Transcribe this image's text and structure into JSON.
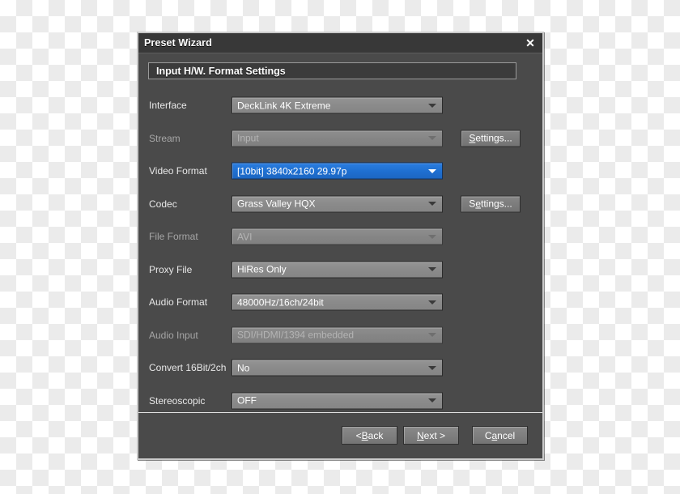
{
  "window": {
    "title": "Preset Wizard",
    "close_icon": "close-icon",
    "close_glyph": "✕"
  },
  "section": {
    "header": "Input H/W. Format Settings"
  },
  "form": {
    "rows": [
      {
        "label": "Interface",
        "value": "DeckLink 4K Extreme",
        "state": "normal",
        "side_button": null
      },
      {
        "label": "Stream",
        "value": "Input",
        "state": "disabled",
        "side_button": "Settings..."
      },
      {
        "label": "Video Format",
        "value": "[10bit] 3840x2160 29.97p",
        "state": "selected",
        "side_button": null
      },
      {
        "label": "Codec",
        "value": "Grass Valley HQX",
        "state": "normal",
        "side_button": "Settings..."
      },
      {
        "label": "File Format",
        "value": "AVI",
        "state": "disabled",
        "side_button": null
      },
      {
        "label": "Proxy File",
        "value": "HiRes Only",
        "state": "normal",
        "side_button": null
      },
      {
        "label": "Audio Format",
        "value": "48000Hz/16ch/24bit",
        "state": "normal",
        "side_button": null
      },
      {
        "label": "Audio Input",
        "value": "SDI/HDMI/1394 embedded",
        "state": "disabled",
        "side_button": null
      },
      {
        "label": "Convert 16Bit/2ch",
        "value": "No",
        "state": "normal",
        "side_button": null
      },
      {
        "label": "Stereoscopic",
        "value": "OFF",
        "state": "normal",
        "side_button": null
      }
    ]
  },
  "side_buttons": {
    "stream_settings": {
      "prefix": "",
      "mnemonic": "S",
      "suffix": "ettings..."
    },
    "codec_settings": {
      "prefix": "S",
      "mnemonic": "e",
      "suffix": "ttings..."
    }
  },
  "footer": {
    "back": {
      "prefix": "< ",
      "mnemonic": "B",
      "suffix": "ack"
    },
    "next": {
      "prefix": "",
      "mnemonic": "N",
      "suffix": "ext >"
    },
    "cancel": {
      "prefix": "C",
      "mnemonic": "a",
      "suffix": "ncel"
    }
  },
  "colors": {
    "dialog_border": "#c9c9c9",
    "titlebar": "#383838",
    "body": "#4a4a4a",
    "combo": "#8a8a8a",
    "accent_selected": "#1f6fd0",
    "text": "#ffffff",
    "text_disabled": "#b4b4b4"
  }
}
